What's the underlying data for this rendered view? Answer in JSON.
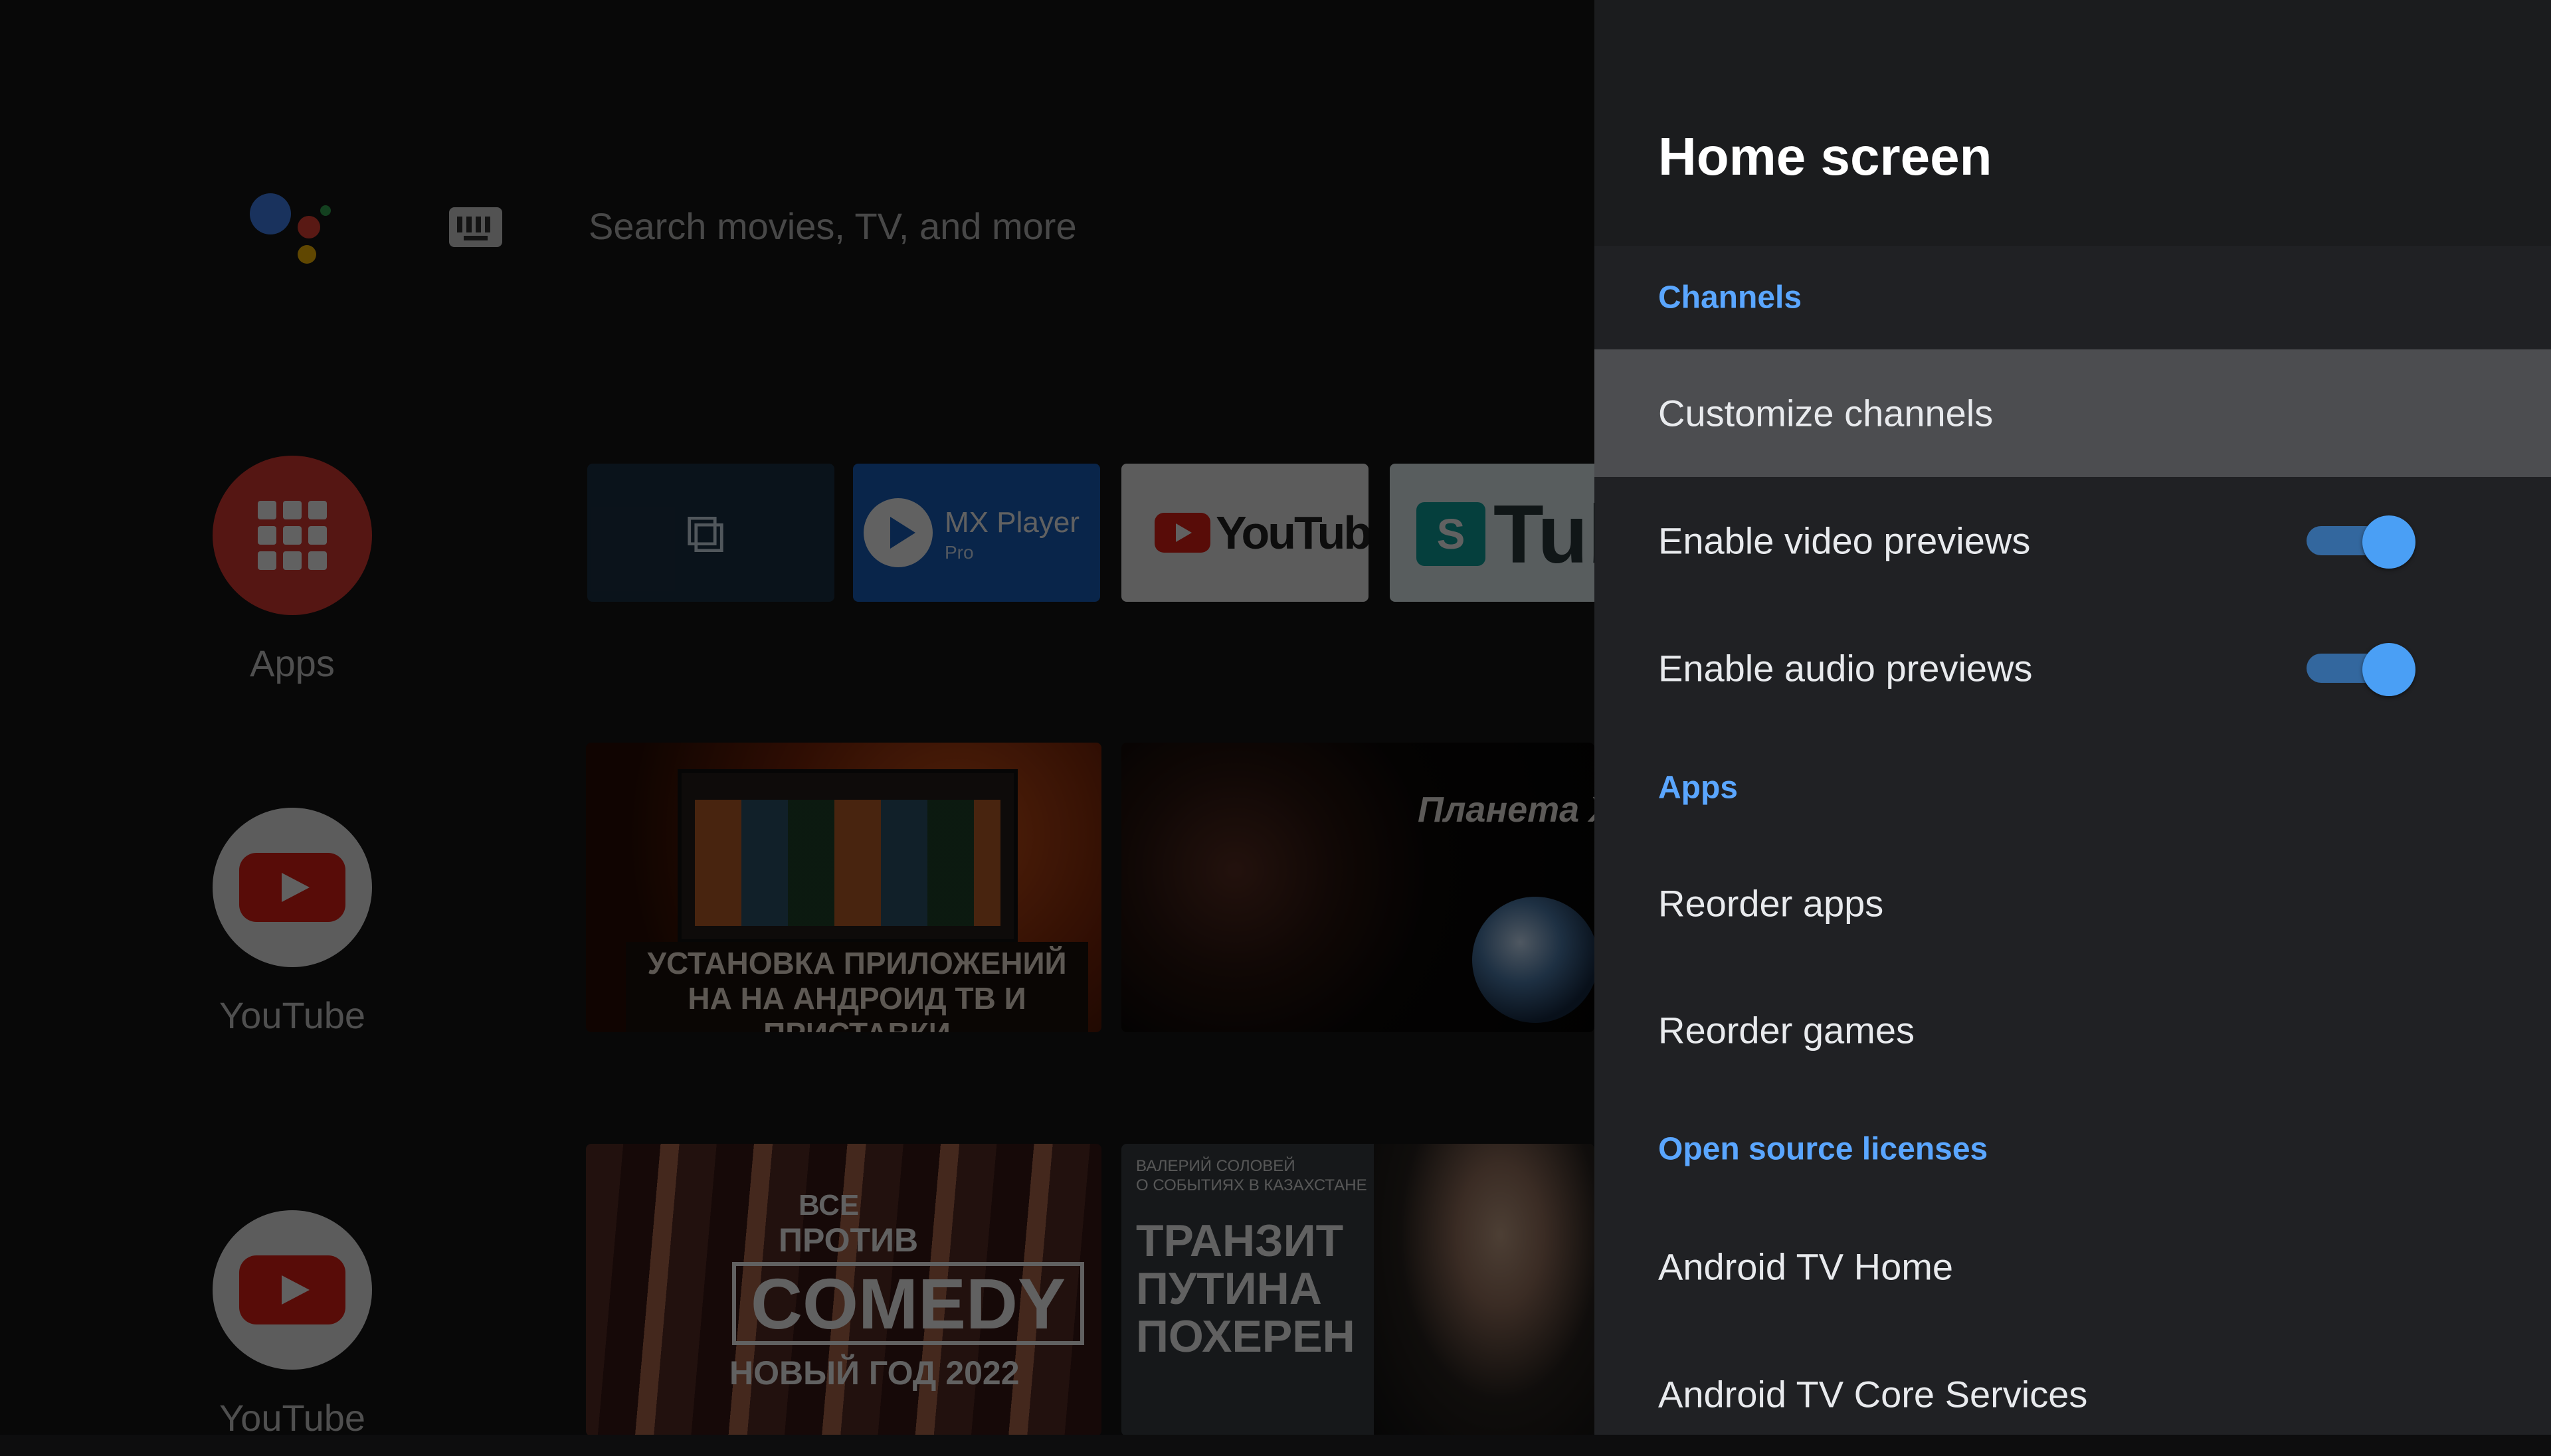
{
  "home": {
    "search_placeholder": "Search movies, TV, and more",
    "sidebar": [
      {
        "label": "Apps",
        "icon": "apps-grid-icon"
      },
      {
        "label": "YouTube",
        "icon": "youtube-icon"
      },
      {
        "label": "YouTube",
        "icon": "youtube-icon"
      }
    ],
    "favorite_apps": [
      {
        "label": "",
        "icon": "open-external-icon"
      },
      {
        "label": "MX Player",
        "sub": "Pro",
        "icon": "play-icon"
      },
      {
        "label": "YouTube",
        "icon": "youtube-icon"
      },
      {
        "label": "Tube",
        "icon": "smarttube-icon"
      }
    ],
    "thumbnails": {
      "video1_caption": "УСТАНОВКА ПРИЛОЖЕНИЙ НА НА АНДРОИД ТВ И ПРИСТАВКИ",
      "video2_title": "Планета X",
      "video3_line1": "ВСЕ",
      "video3_line2": "ПРОТИВ",
      "video3_logo": "COMEDY",
      "video3_line3": "НОВЫЙ ГОД 2022",
      "video4_top_line1": "ВАЛЕРИЙ СОЛОВЕЙ",
      "video4_top_line2": "О СОБЫТИЯХ В КАЗАХСТАНЕ",
      "video4_line1": "ТРАНЗИТ",
      "video4_line2": "ПУТИНА",
      "video4_line3": "ПОХЕРЕН"
    }
  },
  "panel": {
    "title": "Home screen",
    "items": [
      {
        "type": "section",
        "label": "Channels"
      },
      {
        "type": "item",
        "label": "Customize channels",
        "focused": true
      },
      {
        "type": "toggle",
        "label": "Enable video previews",
        "on": true
      },
      {
        "type": "toggle",
        "label": "Enable audio previews",
        "on": true
      },
      {
        "type": "section",
        "label": "Apps"
      },
      {
        "type": "item",
        "label": "Reorder apps"
      },
      {
        "type": "item",
        "label": "Reorder games"
      },
      {
        "type": "section",
        "label": "Open source licenses"
      },
      {
        "type": "item",
        "label": "Android TV Home"
      },
      {
        "type": "item",
        "label": "Android TV Core Services"
      }
    ]
  },
  "colors": {
    "accent": "#5aa6ff",
    "toggle_track": "#33679e",
    "toggle_thumb": "#4a9ff5",
    "panel_bg": "#202124",
    "focus_bg": "#4c4d50"
  }
}
